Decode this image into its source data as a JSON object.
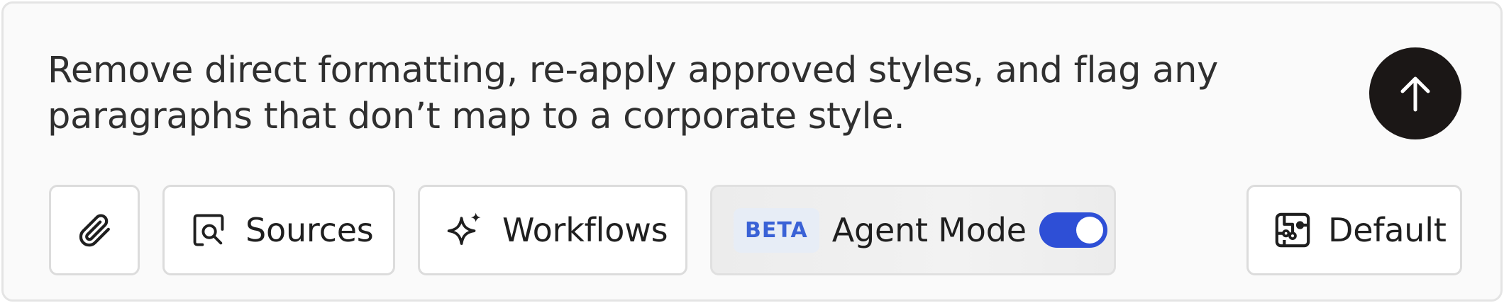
{
  "composer": {
    "prompt_text": "Remove direct formatting, re-apply approved styles, and flag any paragraphs that don’t map to a corporate style."
  },
  "send_button": {
    "icon": "arrow-up-icon"
  },
  "toolbar": {
    "attach": {
      "icon": "paperclip-icon"
    },
    "sources": {
      "label": "Sources",
      "icon": "search-document-icon"
    },
    "workflows": {
      "label": "Workflows",
      "icon": "sparkle-icon"
    },
    "agent_mode": {
      "badge": "BETA",
      "label": "Agent Mode",
      "enabled": true
    },
    "default": {
      "label": "Default",
      "icon": "circuit-board-icon"
    }
  },
  "colors": {
    "send_button_bg": "#1b1716",
    "toggle_on": "#2e4fd6",
    "beta_text": "#3a62d6",
    "beta_bg": "#e7edf6"
  }
}
